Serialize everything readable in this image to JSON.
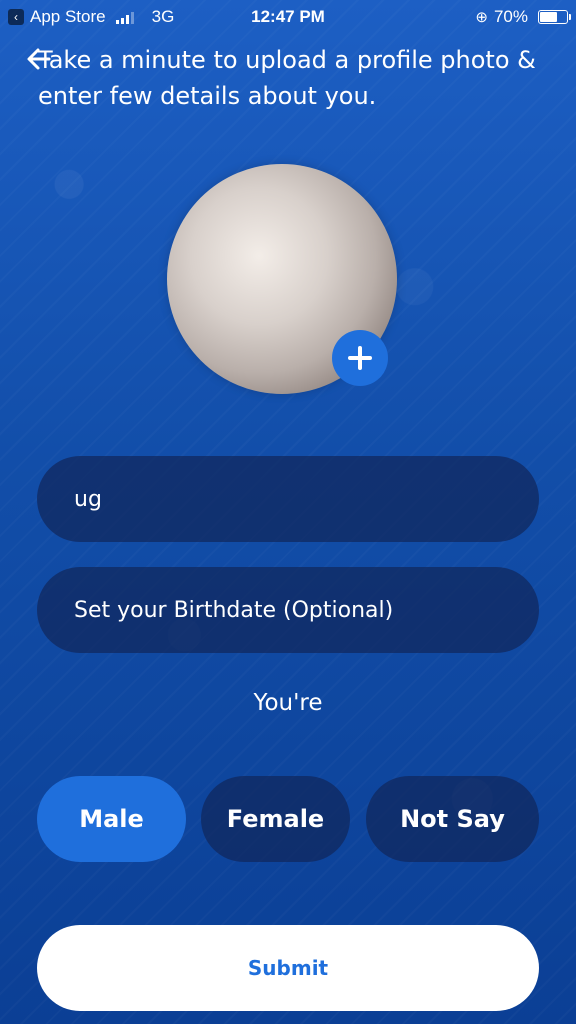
{
  "status_bar": {
    "back_app": "App Store",
    "network": "3G",
    "time": "12:47 PM",
    "battery": "70%",
    "battery_level": 0.7,
    "signal_bars": 3
  },
  "header": {
    "instruction": "Take a minute to upload a profile photo & enter few details about you."
  },
  "profile": {
    "name_value": "ug",
    "birthdate_placeholder": "Set your Birthdate (Optional)"
  },
  "gender": {
    "label": "You're",
    "options": [
      "Male",
      "Female",
      "Not Say"
    ],
    "selected": "Male"
  },
  "actions": {
    "submit_label": "Submit"
  },
  "colors": {
    "accent": "#1f6fdc",
    "background": "#124ea9",
    "field": "#10275c"
  },
  "icons": {
    "back": "arrow-left-icon",
    "add_photo": "plus-icon",
    "lock": "rotation-lock-icon",
    "battery": "battery-icon",
    "signal": "signal-icon"
  }
}
